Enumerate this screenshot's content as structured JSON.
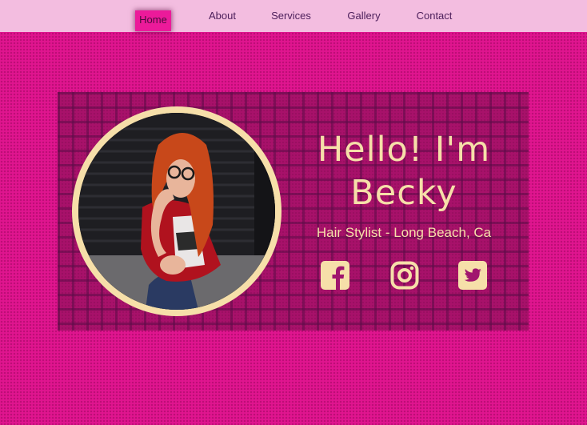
{
  "nav": {
    "items": [
      {
        "label": "Home",
        "active": true
      },
      {
        "label": "About"
      },
      {
        "label": "Services"
      },
      {
        "label": "Gallery"
      },
      {
        "label": "Contact"
      }
    ]
  },
  "hero": {
    "title_line1": "Hello! I'm",
    "title_line2": "Becky",
    "subtitle": "Hair Stylist - Long Beach, Ca",
    "photo_icon": "portrait-photo"
  },
  "social": {
    "icons": [
      "facebook-icon",
      "instagram-icon",
      "twitter-icon"
    ]
  },
  "colors": {
    "background": "#e0158f",
    "navbar": "#f3bde0",
    "nav_active": "#ec1a9a",
    "accent_text": "#f6dfa9",
    "nav_text": "#4b1e5a"
  }
}
